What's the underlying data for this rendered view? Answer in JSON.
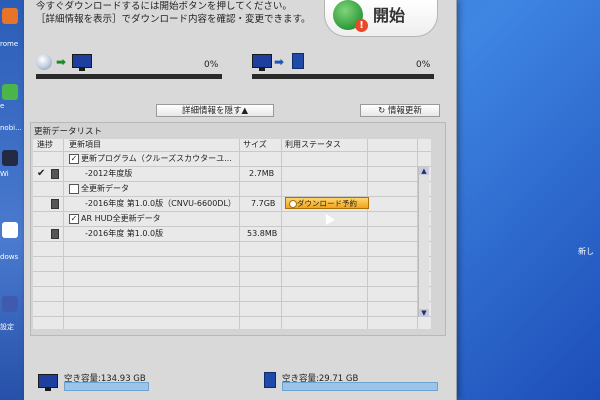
{
  "app": {
    "instructions": {
      "line1": "今すぐダウンロードするには開始ボタンを押してください。",
      "line2": "［詳細情報を表示］でダウンロード内容を確認・変更できます。"
    },
    "start_button": {
      "label": "開始"
    },
    "transfer_internet": {
      "percent_label": "0%",
      "percent_value": 0
    },
    "transfer_sd": {
      "percent_label": "0%",
      "percent_value": 0
    },
    "toggle_detail_label": "詳細情報を隠す▲",
    "refresh_label": "情報更新",
    "list": {
      "title": "更新データリスト",
      "columns": {
        "progress": "進捗",
        "item": "更新項目",
        "size": "サイズ",
        "status": "利用ステータス"
      },
      "rows": [
        {
          "type": "group",
          "checked": true,
          "label": "更新プログラム（クルーズスカウターユ..."
        },
        {
          "type": "item",
          "done": true,
          "label": "-2012年度版",
          "size": "2.7MB",
          "status": ""
        },
        {
          "type": "group",
          "checked": false,
          "label": "全更新データ"
        },
        {
          "type": "item",
          "done": false,
          "label": "-2016年度 第1.0.0版（CNVU-6600DL）",
          "size": "7.7GB",
          "status": "ダウンロード予約"
        },
        {
          "type": "group",
          "checked": true,
          "label": "AR HUD全更新データ"
        },
        {
          "type": "item",
          "done": false,
          "label": "-2016年度 第1.0.0版",
          "size": "53.8MB",
          "status": ""
        }
      ]
    },
    "free_space_pc": {
      "label": "空き容量:134.93 GB",
      "fill_fraction": 0.5
    },
    "free_space_sd": {
      "label": "空き容量:29.71 GB",
      "fill_fraction": 1.0
    }
  },
  "desktop": {
    "labels": [
      "rome",
      "e",
      "nobi...",
      "Wi",
      "dows",
      "設定"
    ],
    "right_label": "新し"
  },
  "colors": {
    "progress_fill": "#3aa2e0",
    "reserve_badge": "#f0a51c",
    "desktop_blue": "#2f6fd4"
  },
  "icons": [
    "internet-globe-icon",
    "pc-monitor-icon",
    "sd-card-icon",
    "refresh-icon",
    "document-icon",
    "checkmark-icon",
    "scroll-up-icon",
    "scroll-down-icon",
    "mouse-cursor-icon"
  ]
}
